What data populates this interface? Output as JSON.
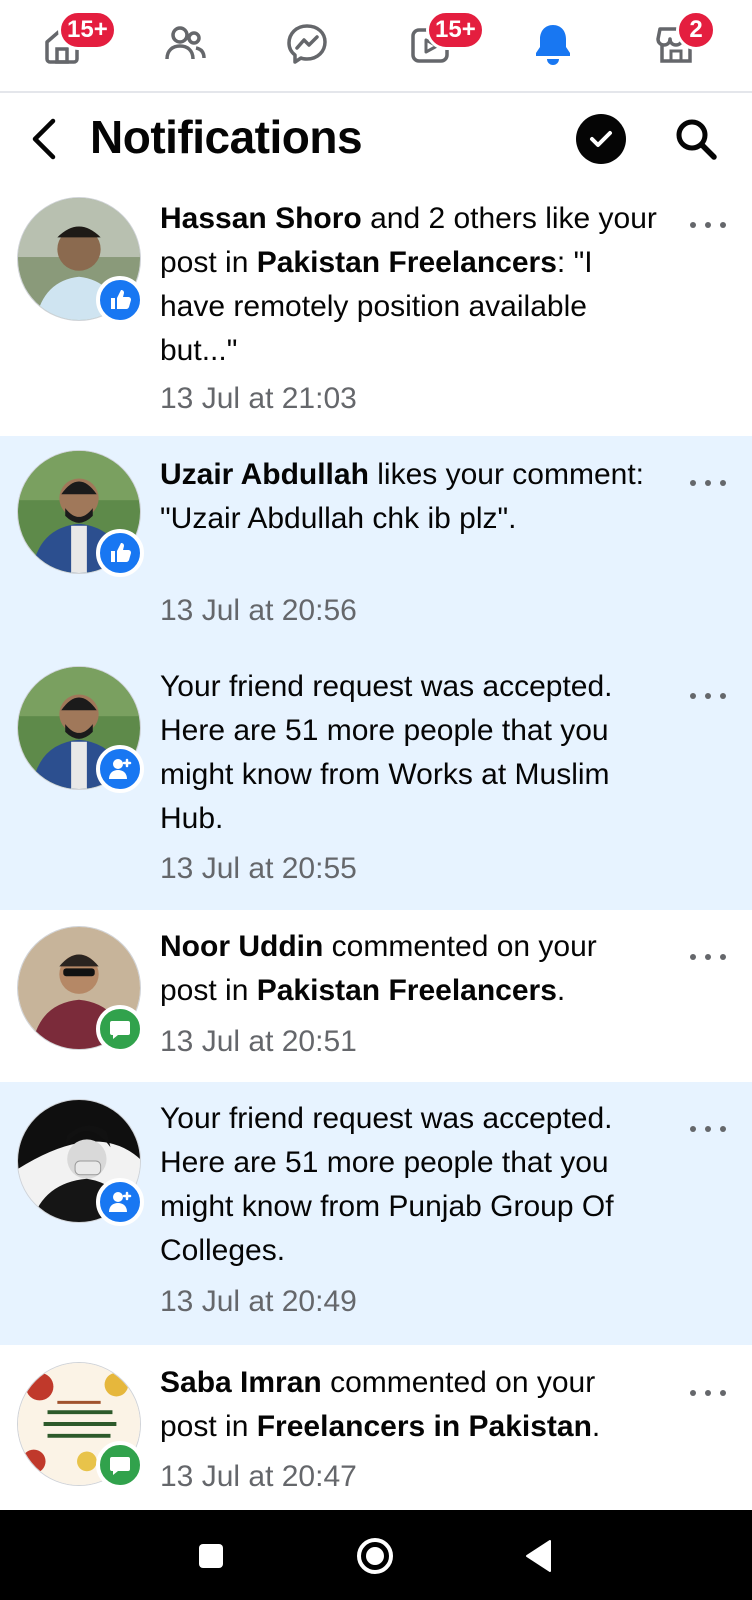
{
  "tabs": [
    {
      "name": "home",
      "badge": "15+"
    },
    {
      "name": "friends",
      "badge": ""
    },
    {
      "name": "messenger",
      "badge": ""
    },
    {
      "name": "watch",
      "badge": "15+"
    },
    {
      "name": "notifications",
      "badge": ""
    },
    {
      "name": "marketplace",
      "badge": "2"
    }
  ],
  "header": {
    "title": "Notifications"
  },
  "notifications": [
    {
      "name": "Hassan Shoro",
      "text1": " and 2 others like your post in ",
      "group": "Pakistan Freelancers",
      "text2": ": \"I have remotely position available but...\"",
      "time": "13 Jul at 21:03",
      "reaction": "like-icon",
      "unread": false
    },
    {
      "name": "Uzair Abdullah",
      "text1": " likes your comment: \"Uzair Abdullah chk ib plz\".",
      "group": "",
      "text2": "",
      "time": "13 Jul at 20:56",
      "reaction": "like-icon",
      "unread": true
    },
    {
      "name": "",
      "text1": "Your friend request was accepted. Here are 51 more people that you might know from Works at Muslim Hub.",
      "group": "",
      "text2": "",
      "time": "13 Jul at 20:55",
      "reaction": "friend-icon",
      "unread": true
    },
    {
      "name": "Noor Uddin",
      "text1": " commented on your post in ",
      "group": "Pakistan Freelancers",
      "text2": ".",
      "time": "13 Jul at 20:51",
      "reaction": "comment-icon",
      "unread": false
    },
    {
      "name": "",
      "text1": "Your friend request was accepted. Here are 51 more people that you might know from Punjab Group Of Colleges.",
      "group": "",
      "text2": "",
      "time": "13 Jul at 20:49",
      "reaction": "friend-icon",
      "unread": true
    },
    {
      "name": "Saba Imran",
      "text1": " commented on your post in ",
      "group": "Freelancers in Pakistan",
      "text2": ".",
      "time": "13 Jul at 20:47",
      "reaction": "comment-icon",
      "unread": false
    }
  ],
  "colors": {
    "brand_blue": "#1877f2",
    "unread_bg": "#e7f3ff",
    "badge_red": "#e41e3f",
    "comment_green": "#31a24c",
    "secondary_text": "#65676b"
  }
}
